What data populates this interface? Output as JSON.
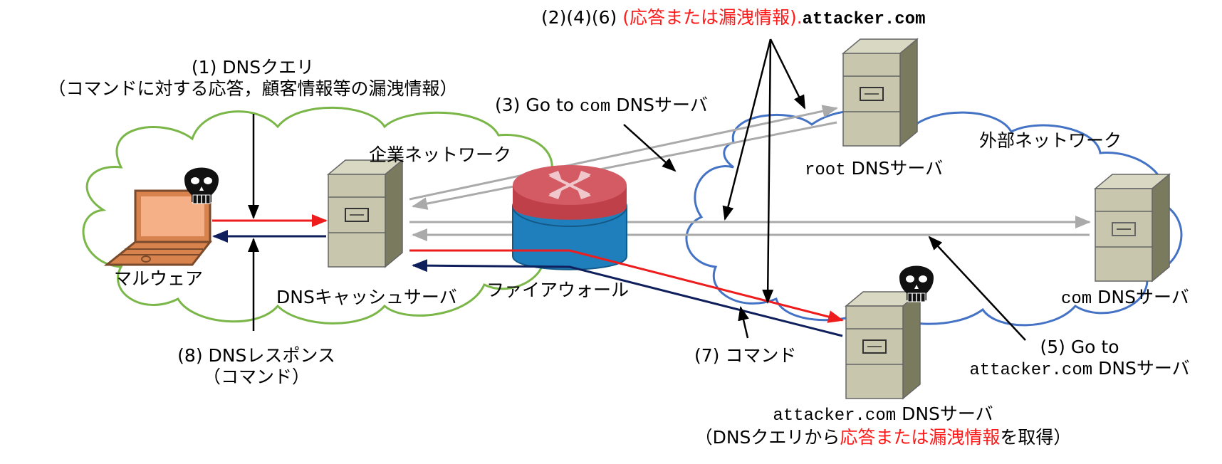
{
  "labels": {
    "top_prefix": "(2)(4)(6) ",
    "top_red": "(応答または漏洩情報).",
    "top_domain": "attacker.com",
    "step1_line1": "(1) DNSクエリ",
    "step1_line2": "（コマンドに対する応答，顧客情報等の漏洩情報）",
    "step3_prefix": "(3) Go to ",
    "step3_mono": "com",
    "step3_suffix": " DNSサーバ",
    "corporate_network": "企業ネットワーク",
    "external_network": "外部ネットワーク",
    "root_mono": "root",
    "root_suffix": " DNSサーバ",
    "malware": "マルウェア",
    "dns_cache_server": "DNSキャッシュサーバ",
    "firewall": "ファイアウォール",
    "com_mono": "com",
    "com_suffix": " DNSサーバ",
    "step8_line1": "(8) DNSレスポンス",
    "step8_line2": "（コマンド）",
    "step7": "(7) コマンド",
    "step5_line1": "(5) Go to",
    "step5_mono": "attacker.com",
    "step5_suffix": " DNSサーバ",
    "attacker_mono": "attacker.com",
    "attacker_suffix": " DNSサーバ",
    "attacker_line2_a": "（DNSクエリから",
    "attacker_line2_red": "応答または漏洩情報",
    "attacker_line2_b": "を取得）"
  },
  "colors": {
    "query_arrow": "#ee1c1c",
    "response_arrow": "#0f1f5c",
    "resolve_arrow": "#aaaaaa",
    "corp_cloud": "#7ab648",
    "ext_cloud": "#4472c4",
    "highlight_text": "#ff1a1a"
  },
  "icons": {
    "malware": "skull-icon",
    "laptop": "laptop-icon",
    "server": "server-icon",
    "firewall": "router-firewall-icon"
  }
}
